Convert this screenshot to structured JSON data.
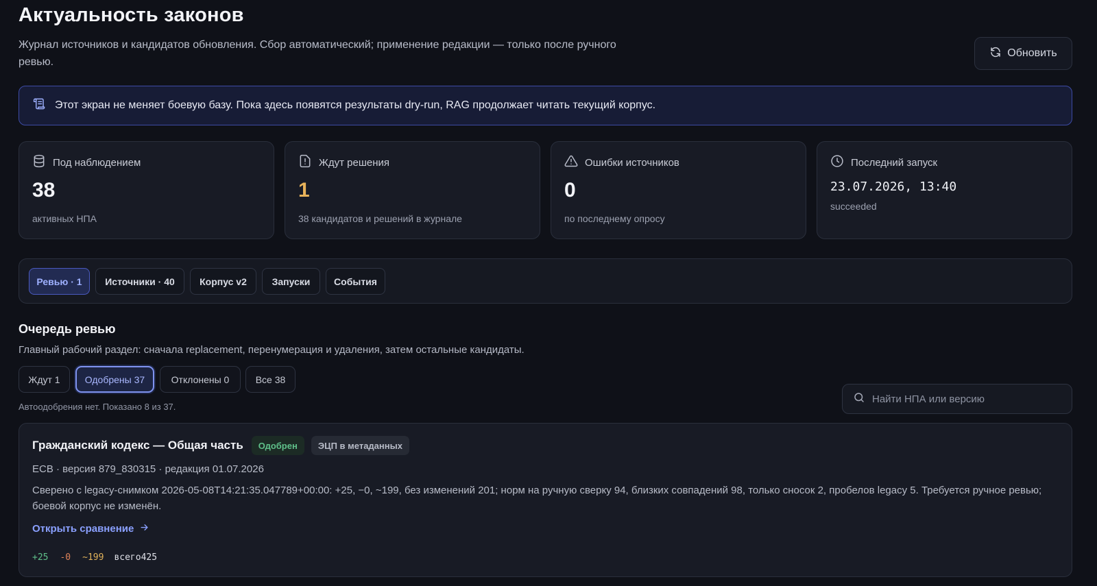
{
  "header": {
    "title": "Актуальность законов",
    "subtitle": "Журнал источников и кандидатов обновления. Сбор автоматический; применение редакции — только после ручного ревью.",
    "refresh_label": "Обновить"
  },
  "banner": {
    "text": "Этот экран не меняет боевую базу. Пока здесь появятся результаты dry-run, RAG продолжает читать текущий корпус."
  },
  "stats": [
    {
      "icon": "database-icon",
      "label": "Под наблюдением",
      "value": "38",
      "sub": "активных НПА"
    },
    {
      "icon": "document-alert-icon",
      "label": "Ждут решения",
      "value": "1",
      "sub": "38 кандидатов и решений в журнале",
      "color": "#e7b25a"
    },
    {
      "icon": "warning-icon",
      "label": "Ошибки источников",
      "value": "0",
      "sub": "по последнему опросу"
    },
    {
      "icon": "clock-icon",
      "label": "Последний запуск",
      "value": "23.07.2026, 13:40",
      "sub": "succeeded"
    }
  ],
  "tabs": [
    {
      "label": "Ревью · 1",
      "active": true
    },
    {
      "label": "Источники · 40"
    },
    {
      "label": "Корпус v2"
    },
    {
      "label": "Запуски"
    },
    {
      "label": "События"
    }
  ],
  "review": {
    "title": "Очередь ревью",
    "description": "Главный рабочий раздел: сначала replacement, перенумерация и удаления, затем остальные кандидаты.",
    "filters": [
      {
        "label": "Ждут 1"
      },
      {
        "label": "Одобрены 37",
        "active": true
      },
      {
        "label": "Отклонены 0"
      },
      {
        "label": "Все 38"
      }
    ],
    "count_text": "Автоодобрения нет. Показано 8 из 37.",
    "search_placeholder": "Найти НПА или версию"
  },
  "items": [
    {
      "title": "Гражданский кодекс — Общая часть",
      "status": "Одобрен",
      "tag": "ЭЦП в метаданных",
      "meta": "ECB · версия 879_830315 · редакция 01.07.2026",
      "description": "Сверено с legacy-снимком 2026-05-08T14:21:35.047789+00:00: +25, −0, ~199, без изменений 201; норм на ручную сверку 94, близких совпадений 98, только сносок 2, пробелов legacy 5. Требуется ручное ревью; боевой корпус не изменён.",
      "link": "Открыть сравнение",
      "diff": {
        "added": "+25",
        "removed": "-0",
        "changed": "~199",
        "total": "всего425"
      }
    }
  ],
  "colors": {
    "background": "#0f1118",
    "accent": "#8aa0ff",
    "success": "#5fc08a",
    "warning": "#e7b25a",
    "danger": "#e0845a"
  }
}
